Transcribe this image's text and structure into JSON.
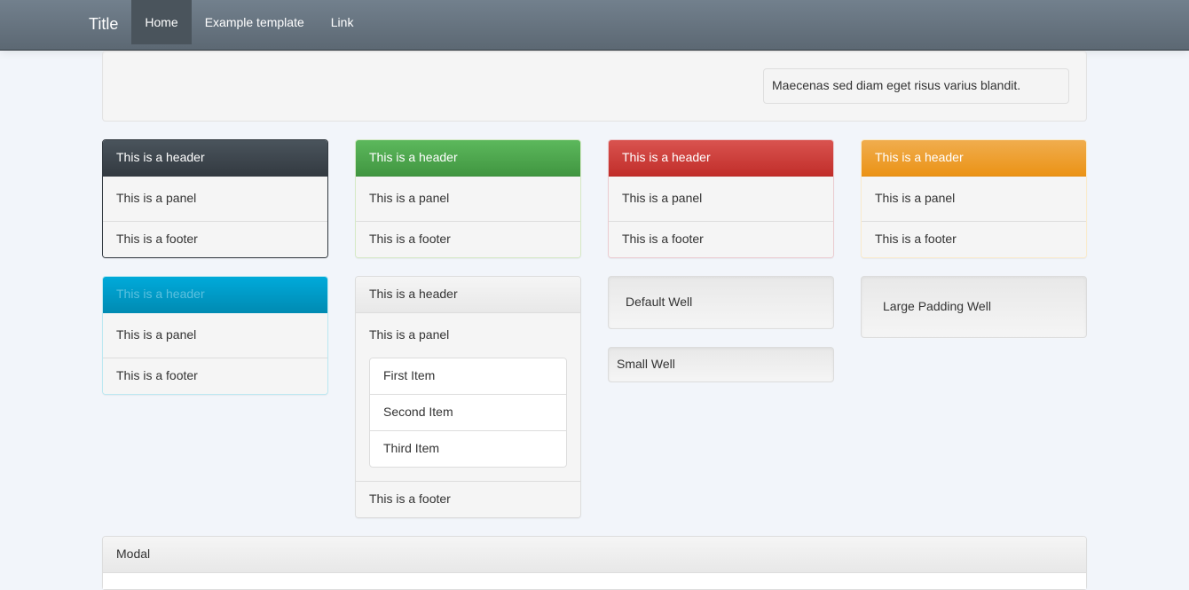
{
  "navbar": {
    "brand": "Title",
    "items": [
      {
        "label": "Home",
        "active": true
      },
      {
        "label": "Example template",
        "active": false
      },
      {
        "label": "Link",
        "active": false
      }
    ]
  },
  "top_well_text": "Maecenas sed diam eget risus varius blandit.",
  "panels_row1": [
    {
      "variant": "primary",
      "header": "This is a header",
      "body": "This is a panel",
      "footer": "This is a footer"
    },
    {
      "variant": "success",
      "header": "This is a header",
      "body": "This is a panel",
      "footer": "This is a footer"
    },
    {
      "variant": "danger",
      "header": "This is a header",
      "body": "This is a panel",
      "footer": "This is a footer"
    },
    {
      "variant": "warning",
      "header": "This is a header",
      "body": "This is a panel",
      "footer": "This is a footer"
    }
  ],
  "panel_info": {
    "header": "This is a header",
    "body": "This is a panel",
    "footer": "This is a footer"
  },
  "panel_list": {
    "header": "This is a header",
    "body": "This is a panel",
    "items": [
      "First Item",
      "Second Item",
      "Third Item"
    ],
    "footer": "This is a footer"
  },
  "wells": {
    "default": "Default Well",
    "small": "Small Well",
    "large": "Large Padding Well"
  },
  "modal_title": "Modal"
}
